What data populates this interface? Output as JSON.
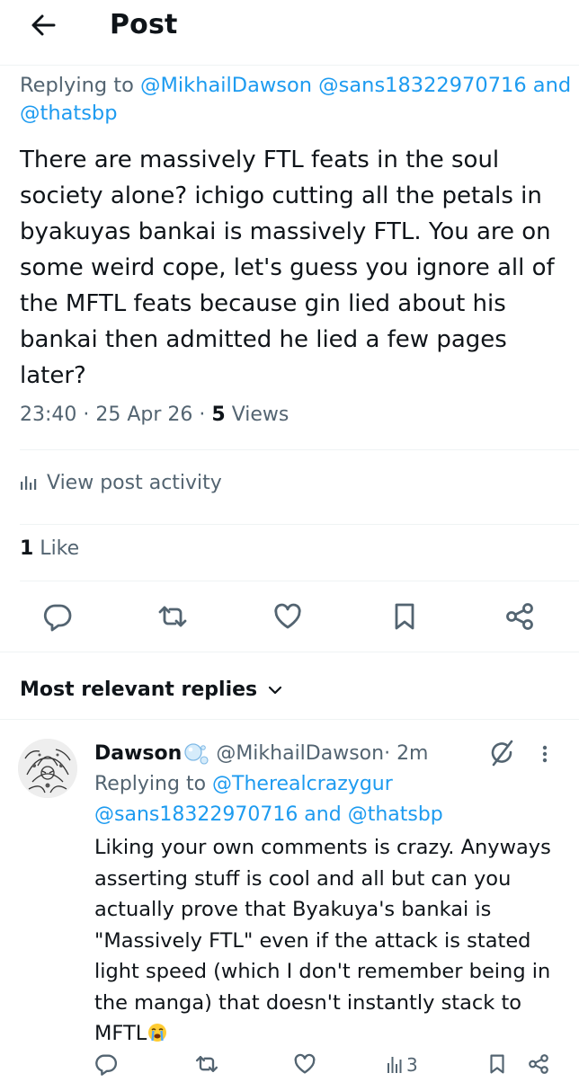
{
  "header": {
    "title": "Post"
  },
  "post": {
    "replying_prefix": "Replying to ",
    "replying_handles": "@MikhailDawson @sans18322970716 and @thatsbp",
    "body": "There are massively FTL feats in the soul society alone? ichigo cutting all the petals in byakuyas bankai is massively FTL. You are on some weird cope, let's guess you ignore all of the MFTL feats because gin lied about his bankai then admitted he lied a few pages later?",
    "time": "23:40 · 25 Apr 26 · ",
    "views_count": "5",
    "views_label": " Views",
    "activity_label": "View post activity",
    "likes_count": "1",
    "likes_label": " Like"
  },
  "actions": [
    "reply",
    "repost",
    "like",
    "bookmark",
    "share"
  ],
  "replies_section": {
    "label": "Most relevant replies"
  },
  "reply": {
    "name": "Dawson",
    "handle": "@MikhailDawson",
    "time": " · 2m",
    "replying_prefix": "Replying to ",
    "replying_handles": "@Therealcrazygur @sans18322970716 and @thatsbp",
    "body": "Liking your own comments is crazy. Anyways asserting stuff is cool and all but can you actually prove that Byakuya's bankai is \"Massively FTL\" even if the attack is stated light speed (which I don't remember being in the manga) that doesn't instantly stack to MFTL",
    "views": "3"
  },
  "colors": {
    "link": "#1d9bf0",
    "secondary": "#536471",
    "text": "#0f1419"
  }
}
